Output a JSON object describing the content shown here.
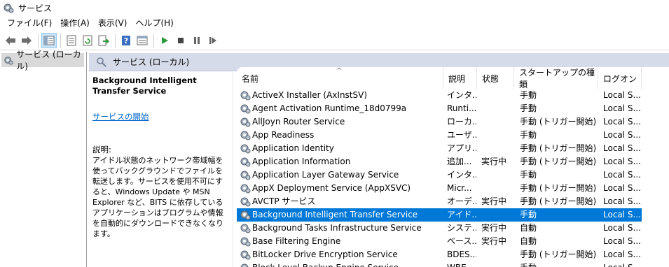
{
  "window": {
    "title": "サービス",
    "icon": "gear-icon"
  },
  "menu": [
    "ファイル(F)",
    "操作(A)",
    "表示(V)",
    "ヘルプ(H)"
  ],
  "toolbar": {
    "buttons": [
      "back-arrow-icon",
      "forward-arrow-icon",
      "console-tree-icon",
      "properties-icon",
      "refresh-icon",
      "export-icon",
      "help-icon",
      "view-icon",
      "play-icon",
      "stop-icon",
      "pause-icon",
      "restart-icon"
    ]
  },
  "tree": {
    "item": "サービス (ローカル)"
  },
  "panel": {
    "header": "サービス (ローカル)"
  },
  "description": {
    "title": "Background Intelligent Transfer Service",
    "start_link": "サービスの開始",
    "label": "説明:",
    "text": "アイドル状態のネットワーク帯域幅を使ってバックグラウンドでファイルを転送します。サービスを使用不可にすると、Windows Update や MSN Explorer など、BITS に依存しているアプリケーションはプログラムや情報を自動的にダウンロードできなくなります。"
  },
  "columns": [
    "名前",
    "説明",
    "状態",
    "スタートアップの種類",
    "ログオン"
  ],
  "rows": [
    {
      "name": "ActiveX Installer (AxInstSV)",
      "desc": "インタ...",
      "status": "",
      "startup": "手動",
      "logon": "Local S..."
    },
    {
      "name": "Agent Activation Runtime_18d0799a",
      "desc": "Runti...",
      "status": "",
      "startup": "手動",
      "logon": "Local S..."
    },
    {
      "name": "AllJoyn Router Service",
      "desc": "ローカ...",
      "status": "",
      "startup": "手動 (トリガー開始)",
      "logon": "Local S..."
    },
    {
      "name": "App Readiness",
      "desc": "ユーザ...",
      "status": "",
      "startup": "手動",
      "logon": "Local S..."
    },
    {
      "name": "Application Identity",
      "desc": "アプリ...",
      "status": "",
      "startup": "手動 (トリガー開始)",
      "logon": "Local S..."
    },
    {
      "name": "Application Information",
      "desc": "追加...",
      "status": "実行中",
      "startup": "手動 (トリガー開始)",
      "logon": "Local S..."
    },
    {
      "name": "Application Layer Gateway Service",
      "desc": "インタ...",
      "status": "",
      "startup": "手動",
      "logon": "Local S..."
    },
    {
      "name": "AppX Deployment Service (AppXSVC)",
      "desc": "Micr...",
      "status": "",
      "startup": "手動 (トリガー開始)",
      "logon": "Local S..."
    },
    {
      "name": "AVCTP サービス",
      "desc": "オーデ...",
      "status": "実行中",
      "startup": "手動 (トリガー開始)",
      "logon": "Local S..."
    },
    {
      "name": "Background Intelligent Transfer Service",
      "desc": "アイド...",
      "status": "",
      "startup": "手動",
      "logon": "Local S...",
      "selected": true
    },
    {
      "name": "Background Tasks Infrastructure Service",
      "desc": "システ...",
      "status": "実行中",
      "startup": "自動",
      "logon": "Local S..."
    },
    {
      "name": "Base Filtering Engine",
      "desc": "ベース...",
      "status": "実行中",
      "startup": "自動",
      "logon": "Local S..."
    },
    {
      "name": "BitLocker Drive Encryption Service",
      "desc": "BDES...",
      "status": "",
      "startup": "手動 (トリガー開始)",
      "logon": "Local S..."
    },
    {
      "name": "Block Level Backup Engine Service",
      "desc": "WBE...",
      "status": "",
      "startup": "手動",
      "logon": "Local S..."
    }
  ],
  "colors": {
    "selection": "#0078d7",
    "link": "#0066cc",
    "header_bg": "#d6dbe9"
  }
}
